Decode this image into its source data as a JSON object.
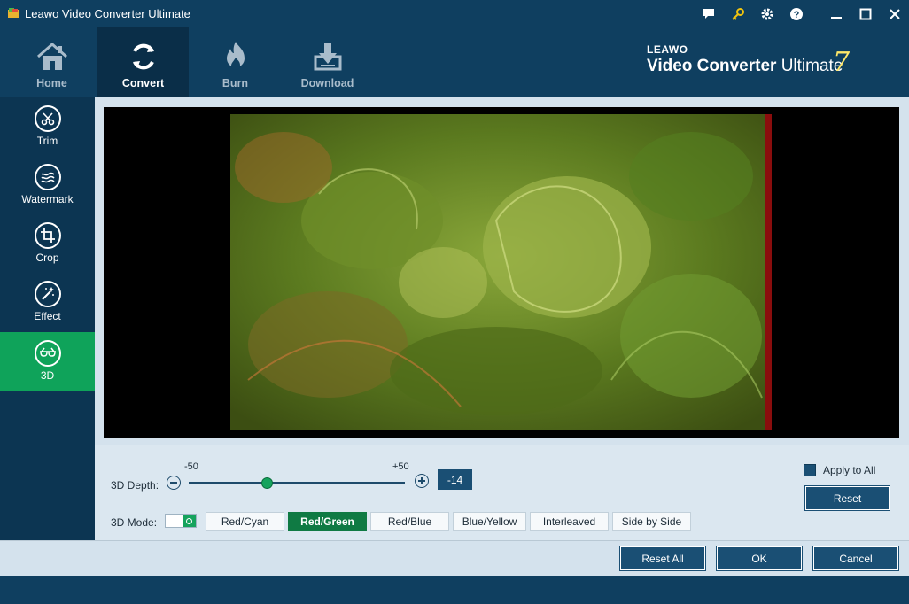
{
  "window": {
    "title": "Leawo Video Converter Ultimate"
  },
  "titlebar_icons": [
    "chat-icon",
    "key-icon",
    "gear-icon",
    "help-icon",
    "minimize-icon",
    "maximize-icon",
    "close-icon"
  ],
  "nav": {
    "items": [
      {
        "label": "Home",
        "icon": "home-icon"
      },
      {
        "label": "Convert",
        "icon": "convert-icon",
        "active": true
      },
      {
        "label": "Burn",
        "icon": "burn-icon"
      },
      {
        "label": "Download",
        "icon": "download-icon"
      }
    ]
  },
  "brand": {
    "top": "LEAWO",
    "name_bold": "Video Converter",
    "name_light": " Ultimate",
    "version": "7"
  },
  "sidebar": {
    "items": [
      {
        "label": "Trim",
        "icon": "scissors-icon"
      },
      {
        "label": "Watermark",
        "icon": "watermark-icon"
      },
      {
        "label": "Crop",
        "icon": "crop-icon"
      },
      {
        "label": "Effect",
        "icon": "effect-wand-icon"
      },
      {
        "label": "3D",
        "icon": "3d-glasses-icon",
        "active": true
      }
    ]
  },
  "depth": {
    "label": "3D Depth:",
    "min_label": "-50",
    "max_label": "+50",
    "min": -50,
    "max": 50,
    "value": -14,
    "value_text": "-14"
  },
  "mode": {
    "label": "3D Mode:",
    "enabled": true,
    "options": [
      "Red/Cyan",
      "Red/Green",
      "Red/Blue",
      "Blue/Yellow",
      "Interleaved",
      "Side by Side"
    ],
    "selected": "Red/Green"
  },
  "apply_all": {
    "label": "Apply to All",
    "checked": true
  },
  "buttons": {
    "reset": "Reset",
    "reset_all": "Reset All",
    "ok": "OK",
    "cancel": "Cancel"
  },
  "colors": {
    "accent_green": "#0fa35a",
    "navy": "#0f3f60",
    "button_blue": "#1a4f74",
    "panel_bg": "#d4e2ed"
  }
}
